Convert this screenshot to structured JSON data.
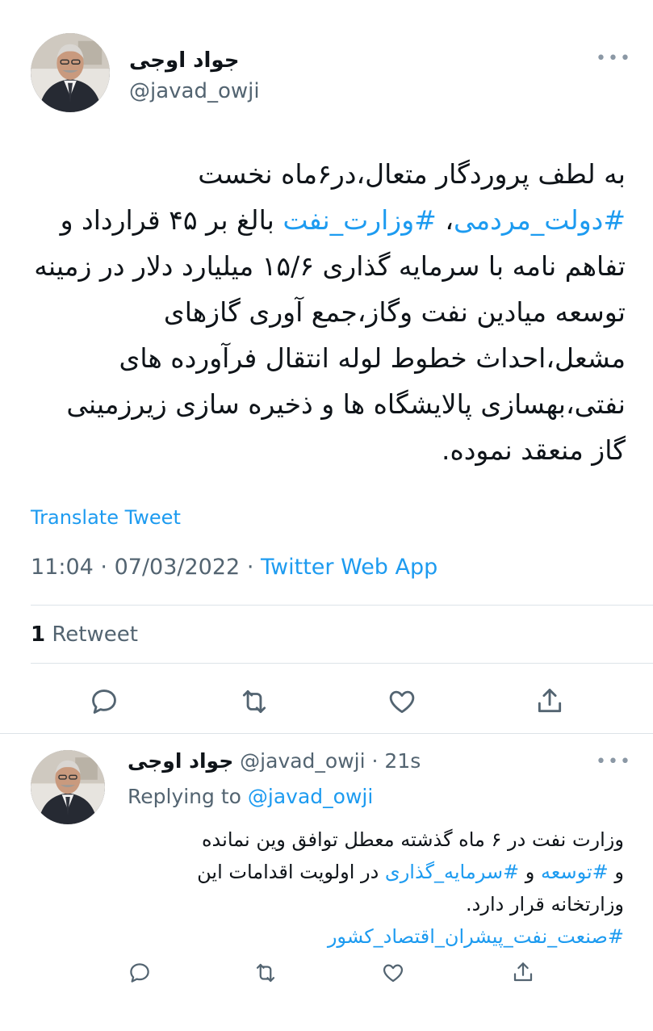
{
  "main_tweet": {
    "author_name": "جواد اوجی",
    "author_handle": "@javad_owji",
    "text_pre": "به لطف پروردگار متعال،در۶ماه نخست ",
    "hashtag1": "#دولت_مردمی",
    "sep": "، ",
    "hashtag2": "#وزارت_نفت",
    "text_post": " بالغ بر ۴۵ قرارداد و تفاهم نامه با سرمایه گذاری ۱۵/۶ میلیارد دلار در زمینه توسعه میادین نفت وگاز،جمع آوری گازهای مشعل،احداث خطوط لوله انتقال فرآورده های نفتی،بهسازی پالایشگاه ها و ذخیره سازی زیرزمینی گاز منعقد نموده.",
    "translate_label": "Translate Tweet",
    "time": "11:04",
    "date": "07/03/2022",
    "dot": "·",
    "source": "Twitter Web App",
    "retweet_count": "1",
    "retweet_label": "Retweet"
  },
  "reply_tweet": {
    "author_name": "جواد اوجی",
    "author_handle": "@javad_owji",
    "dot": "·",
    "time_ago": "21s",
    "replying_to_label": "Replying to",
    "replying_to_handle": "@javad_owji",
    "line1": "وزارت نفت در ۶ ماه گذشته معطل توافق وین نمانده",
    "line2_pre": "و ",
    "tag1": "#توسعه",
    "line2_mid": " و ",
    "tag2": "#سرمایه_گذاری",
    "line2_post": " در اولویت اقدامات این",
    "line3": "وزارتخانه قرار دارد.",
    "tag3": "#صنعت_نفت_پیشران_اقتصاد_کشور"
  },
  "icons": {
    "more": "more-dots-icon",
    "reply": "reply-icon",
    "retweet": "retweet-icon",
    "like": "heart-icon",
    "share": "share-icon"
  },
  "colors": {
    "accent": "#1d9bf0",
    "text": "#0f1419",
    "muted": "#536471",
    "divider": "#dde3e8"
  }
}
